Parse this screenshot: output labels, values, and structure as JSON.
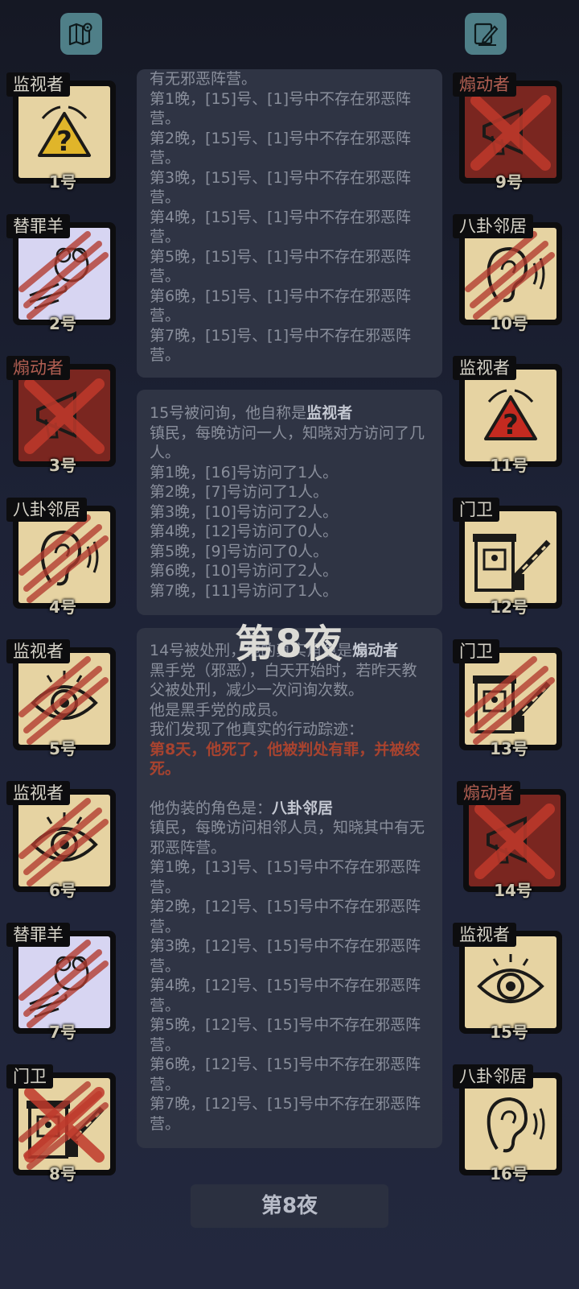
{
  "title": "第8夜",
  "night_button": "第8夜",
  "icons": {
    "left_top": "map-icon",
    "right_top": "notes-pen-icon"
  },
  "colors": {
    "card_bg": "#e6d3a2",
    "scapegoat_bg": "#d7d5f2",
    "evil_bg": "#7a2620",
    "claw": "#b23a2e",
    "x_mark": "#c0392b"
  },
  "players": [
    {
      "num": "1号",
      "role": "监视者",
      "icon": "warning-triangle-icon",
      "faction": "good",
      "marks": []
    },
    {
      "num": "2号",
      "role": "替罪羊",
      "icon": "sheep-hand-icon",
      "faction": "good",
      "marks": [
        "claw"
      ]
    },
    {
      "num": "3号",
      "role": "煽动者",
      "icon": "horn-icon",
      "faction": "evil",
      "marks": [
        "x"
      ]
    },
    {
      "num": "4号",
      "role": "八卦邻居",
      "icon": "ear-icon",
      "faction": "good",
      "marks": [
        "claw"
      ]
    },
    {
      "num": "5号",
      "role": "监视者",
      "icon": "eye-icon",
      "faction": "good",
      "marks": [
        "claw"
      ]
    },
    {
      "num": "6号",
      "role": "监视者",
      "icon": "eye-icon",
      "faction": "good",
      "marks": [
        "claw"
      ]
    },
    {
      "num": "7号",
      "role": "替罪羊",
      "icon": "sheep-hand-icon",
      "faction": "good",
      "marks": [
        "claw"
      ]
    },
    {
      "num": "8号",
      "role": "门卫",
      "icon": "gate-booth-icon",
      "faction": "good",
      "marks": [
        "claw",
        "x"
      ]
    },
    {
      "num": "9号",
      "role": "煽动者",
      "icon": "horn-icon",
      "faction": "evil",
      "marks": [
        "x"
      ]
    },
    {
      "num": "10号",
      "role": "八卦邻居",
      "icon": "ear-icon",
      "faction": "good",
      "marks": [
        "claw"
      ]
    },
    {
      "num": "11号",
      "role": "监视者",
      "icon": "warning-triangle-red-icon",
      "faction": "good",
      "marks": []
    },
    {
      "num": "12号",
      "role": "门卫",
      "icon": "gate-booth-icon",
      "faction": "good",
      "marks": []
    },
    {
      "num": "13号",
      "role": "门卫",
      "icon": "gate-booth-icon",
      "faction": "good",
      "marks": [
        "claw"
      ]
    },
    {
      "num": "14号",
      "role": "煽动者",
      "icon": "horn-icon",
      "faction": "evil",
      "marks": [
        "x"
      ]
    },
    {
      "num": "15号",
      "role": "监视者",
      "icon": "eye-icon",
      "faction": "good",
      "marks": []
    },
    {
      "num": "16号",
      "role": "八卦邻居",
      "icon": "ear-icon",
      "faction": "good",
      "marks": []
    }
  ],
  "log": {
    "panel1": {
      "head": "有无邪恶阵营。",
      "lines": [
        "第1晚，[15]号、[1]号中不存在邪恶阵营。",
        "第2晚，[15]号、[1]号中不存在邪恶阵营。",
        "第3晚，[15]号、[1]号中不存在邪恶阵营。",
        "第4晚，[15]号、[1]号中不存在邪恶阵营。",
        "第5晚，[15]号、[1]号中不存在邪恶阵营。",
        "第6晚，[15]号、[1]号中不存在邪恶阵营。",
        "第7晚，[15]号、[1]号中不存在邪恶阵营。"
      ]
    },
    "panel2": {
      "intro": "15号被问询，他自称是",
      "intro_role": "监视者",
      "desc": "镇民，每晚访问一人，知晓对方访问了几人。",
      "lines": [
        "第1晚，[16]号访问了1人。",
        "第2晚，[7]号访问了1人。",
        "第3晚，[10]号访问了2人。",
        "第4晚，[12]号访问了0人。",
        "第5晚，[9]号访问了0人。",
        "第6晚，[10]号访问了2人。",
        "第7晚，[11]号访问了1人。"
      ]
    },
    "panel3": {
      "intro": "14号被处刑，他的真实角色是",
      "intro_role": "煽动者",
      "desc": "黑手党（邪恶），白天开始时，若昨天教父被处刑，减少一次问询次数。",
      "member": "他是黑手党的成员。",
      "trace_label": "我们发现了他真实的行动踪迹：",
      "trace": "第8天，他死了，他被判处有罪，并被绞死。",
      "disguise_label": "他伪装的角色是：",
      "disguise_role": "八卦邻居",
      "disguise_desc": "镇民，每晚访问相邻人员，知晓其中有无邪恶阵营。",
      "lines": [
        "第1晚，[13]号、[15]号中不存在邪恶阵营。",
        "第2晚，[12]号、[15]号中不存在邪恶阵营。",
        "第3晚，[12]号、[15]号中不存在邪恶阵营。",
        "第4晚，[12]号、[15]号中不存在邪恶阵营。",
        "第5晚，[12]号、[15]号中不存在邪恶阵营。",
        "第6晚，[12]号、[15]号中不存在邪恶阵营。",
        "第7晚，[12]号、[15]号中不存在邪恶阵营。"
      ]
    }
  }
}
